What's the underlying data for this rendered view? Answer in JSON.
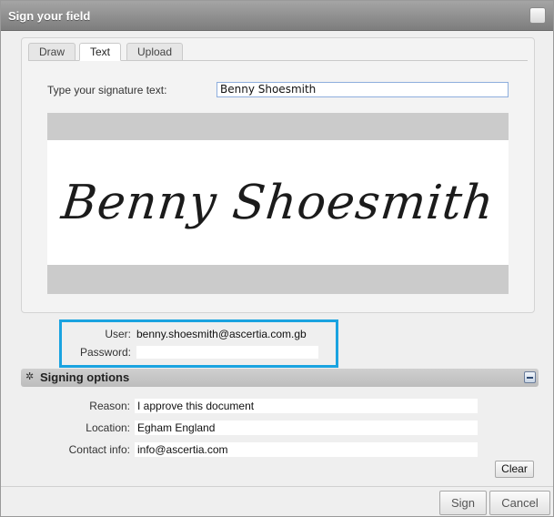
{
  "dialog": {
    "title": "Sign your field"
  },
  "tabs": [
    {
      "label": "Draw"
    },
    {
      "label": "Text"
    },
    {
      "label": "Upload"
    }
  ],
  "active_tab": "Text",
  "signature": {
    "label": "Type your signature text:",
    "value": "Benny Shoesmith",
    "preview_text": "Benny Shoesmith"
  },
  "credentials": {
    "user_label": "User:",
    "user_value": "benny.shoesmith@ascertia.com.gb",
    "password_label": "Password:",
    "password_value": "",
    "highlight_color": "#1aa3e0"
  },
  "signing_options": {
    "title": "Signing options",
    "reason_label": "Reason:",
    "reason_value": "I approve this document",
    "location_label": "Location:",
    "location_value": "Egham England",
    "contact_label": "Contact info:",
    "contact_value": "info@ascertia.com",
    "clear_label": "Clear"
  },
  "footer": {
    "sign_label": "Sign",
    "cancel_label": "Cancel"
  }
}
